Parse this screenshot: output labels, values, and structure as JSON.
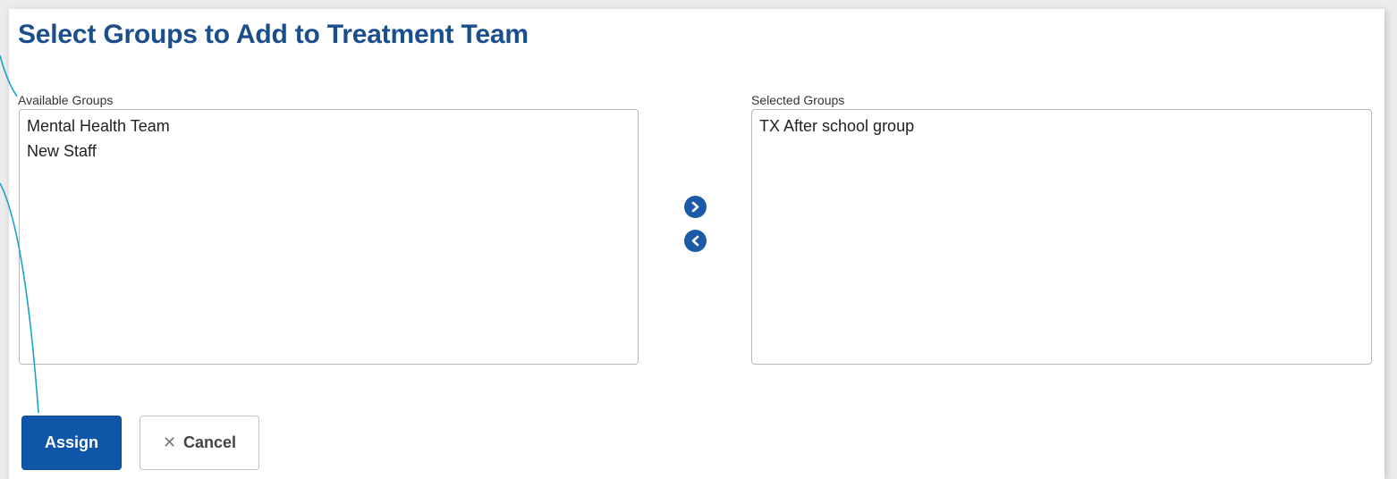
{
  "dialog": {
    "title": "Select Groups to Add to Treatment Team"
  },
  "available": {
    "label": "Available Groups",
    "items": [
      "Mental Health Team",
      "New Staff"
    ]
  },
  "selected": {
    "label": "Selected Groups",
    "items": [
      "TX After school group"
    ]
  },
  "actions": {
    "move_right_icon": "chevron-right-circle-icon",
    "move_left_icon": "chevron-left-circle-icon",
    "assign_label": "Assign",
    "cancel_icon": "close-icon",
    "cancel_label": "Cancel"
  },
  "colors": {
    "title": "#1b4e8c",
    "primary_button": "#0f56a8",
    "move_icon": "#1a5aa6",
    "callout_line": "#1aa3c8"
  }
}
